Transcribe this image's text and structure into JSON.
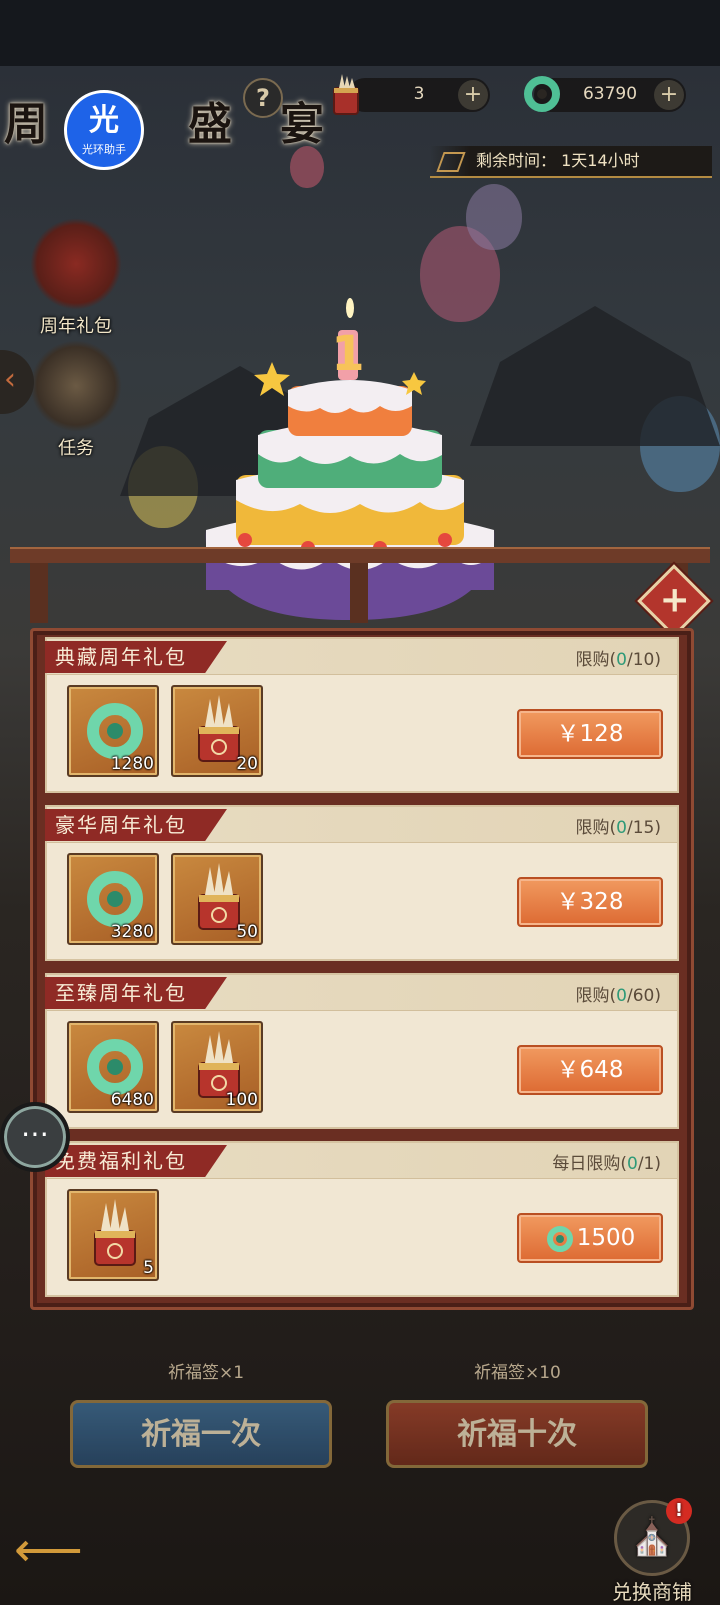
{
  "header": {
    "title": "周年盛宴",
    "help_icon": "question-mark",
    "currencies": [
      {
        "icon": "prayer-token-icon",
        "value": "3"
      },
      {
        "icon": "jade-dragon-icon",
        "value": "63790"
      }
    ],
    "timer_label": "剩余时间：",
    "timer_value": "1天14小时"
  },
  "overlay_badge": {
    "glyph": "光",
    "text": "光环助手"
  },
  "side_menu": [
    {
      "label": "周年礼包",
      "icon": "gift-chest-icon"
    },
    {
      "label": "任务",
      "icon": "scroll-icon"
    }
  ],
  "cake": {
    "number": "1"
  },
  "packs": [
    {
      "name": "典藏周年礼包",
      "limit_prefix": "限购(",
      "limit_used": "0",
      "limit_total": "/10)",
      "items": [
        {
          "icon": "jade-dragon-icon",
          "count": "1280"
        },
        {
          "icon": "prayer-token-icon",
          "count": "20"
        }
      ],
      "price_label": "￥128",
      "price_type": "cash"
    },
    {
      "name": "豪华周年礼包",
      "limit_prefix": "限购(",
      "limit_used": "0",
      "limit_total": "/15)",
      "items": [
        {
          "icon": "jade-dragon-icon",
          "count": "3280"
        },
        {
          "icon": "prayer-token-icon",
          "count": "50"
        }
      ],
      "price_label": "￥328",
      "price_type": "cash"
    },
    {
      "name": "至臻周年礼包",
      "limit_prefix": "限购(",
      "limit_used": "0",
      "limit_total": "/60)",
      "items": [
        {
          "icon": "jade-dragon-icon",
          "count": "6480"
        },
        {
          "icon": "prayer-token-icon",
          "count": "100"
        }
      ],
      "price_label": "￥648",
      "price_type": "cash"
    },
    {
      "name": "免费福利礼包",
      "limit_prefix": "每日限购(",
      "limit_used": "0",
      "limit_total": "/1)",
      "items": [
        {
          "icon": "prayer-token-icon",
          "count": "5"
        }
      ],
      "price_label": "1500",
      "price_type": "jade"
    }
  ],
  "bottom": {
    "tag_once": "祈福签×1",
    "tag_ten": "祈福签×10",
    "pray_once": "祈福一次",
    "pray_ten": "祈福十次",
    "shop_label": "兑换商铺",
    "shop_badge": "!"
  },
  "colors": {
    "accent_red": "#8f2a25",
    "buy_orange": "#e6783e",
    "limit_green": "#2f9a78",
    "panel_brown": "#6a2e22"
  }
}
